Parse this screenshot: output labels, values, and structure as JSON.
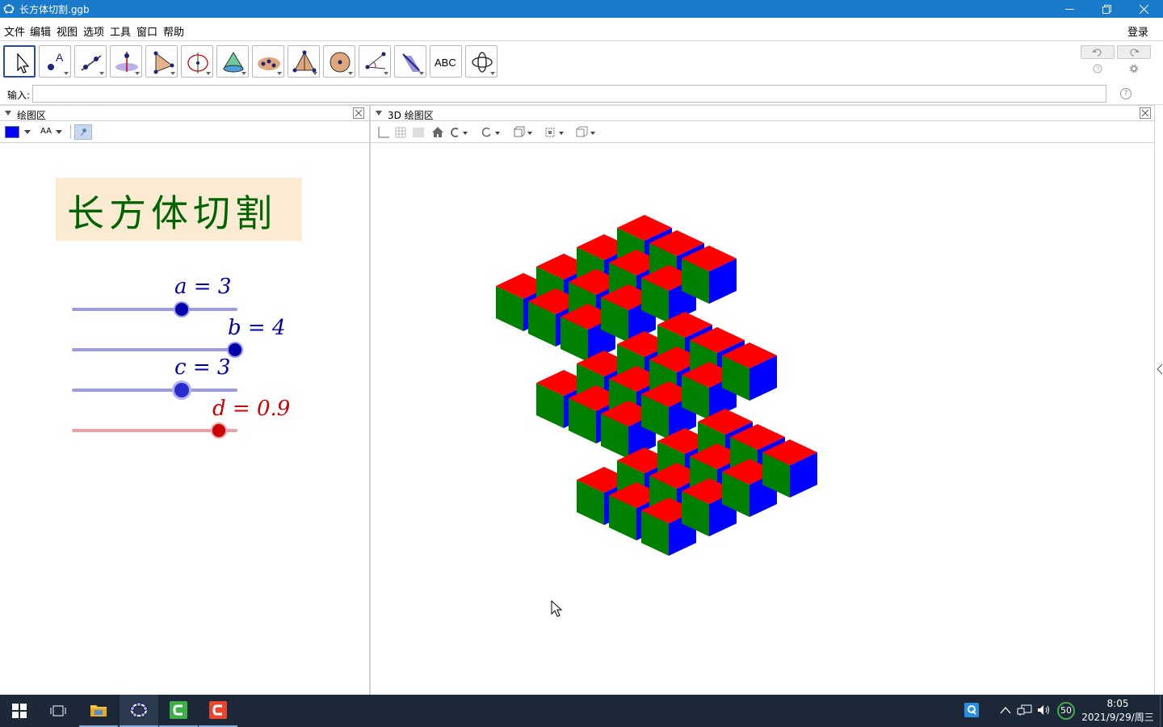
{
  "window": {
    "title": "长方体切割.ggb"
  },
  "menu": {
    "items": [
      "文件",
      "编辑",
      "视图",
      "选项",
      "工具",
      "窗口",
      "帮助"
    ],
    "login": "登录"
  },
  "input_bar": {
    "label": "输入:",
    "value": ""
  },
  "graphics_panel": {
    "title": "绘图区",
    "stylebar_color": "#0000ff",
    "font_size_label": "AA",
    "heading": "长方体切割",
    "sliders": [
      {
        "label": "a = 3",
        "color": "#0000aa",
        "value_fraction": 0.75
      },
      {
        "label": "b = 4",
        "color": "#0000aa",
        "value_fraction": 1.0
      },
      {
        "label": "c = 3",
        "color": "#0000aa",
        "value_fraction": 0.75
      },
      {
        "label": "d = 0.9",
        "color": "#cc0000",
        "value_fraction": 0.9
      }
    ]
  },
  "graphics3d_panel": {
    "title": "3D 绘图区",
    "cube_colors": {
      "top": "#ff0000",
      "left": "#008000",
      "right": "#0000ff"
    }
  },
  "taskbar": {
    "time": "8:05",
    "date": "2021/9/29/周三",
    "tray_number": "50"
  }
}
